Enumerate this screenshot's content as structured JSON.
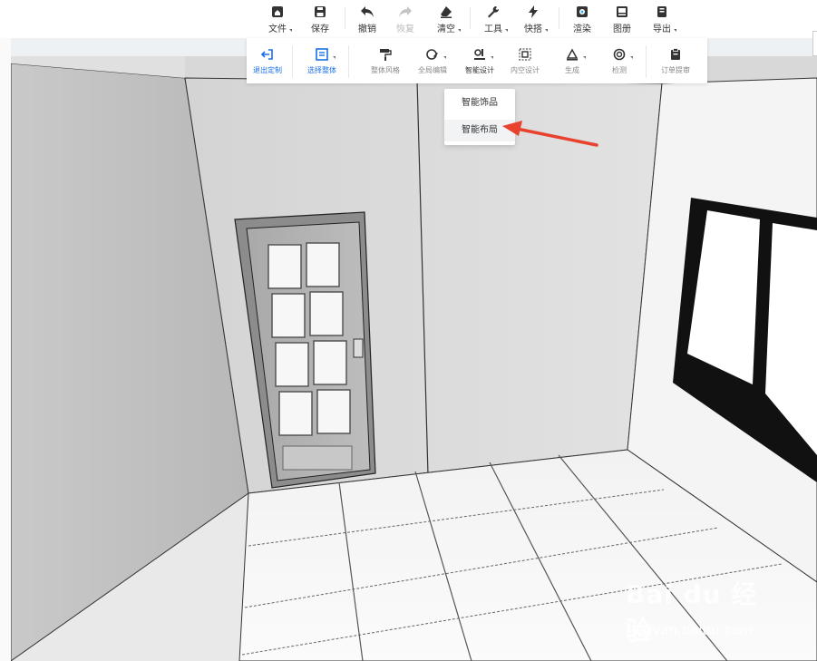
{
  "toolbar": {
    "file": "文件",
    "save": "保存",
    "undo": "撤销",
    "redo": "恢复",
    "clear": "清空",
    "tools": "工具",
    "quick": "快搭",
    "render": "渲染",
    "gallery": "图册",
    "export": "导出"
  },
  "subtoolbar": {
    "exit": "退出定制",
    "select_all": "选择整体",
    "style": "整体风格",
    "global_edit": "全局编辑",
    "smart_design": "智能设计",
    "inner_design": "内空设计",
    "generate": "生成",
    "inspect": "检测",
    "order": "订单提审"
  },
  "smart_menu": {
    "items": [
      "智能饰品",
      "智能布局"
    ],
    "highlighted": "智能布局"
  },
  "watermark": {
    "logo": "Bai du 经验",
    "url": "jingyan.baidu.com"
  },
  "colors": {
    "accent": "#1b6fe8",
    "arrow": "#e8412e",
    "window_frame": "#111111"
  }
}
